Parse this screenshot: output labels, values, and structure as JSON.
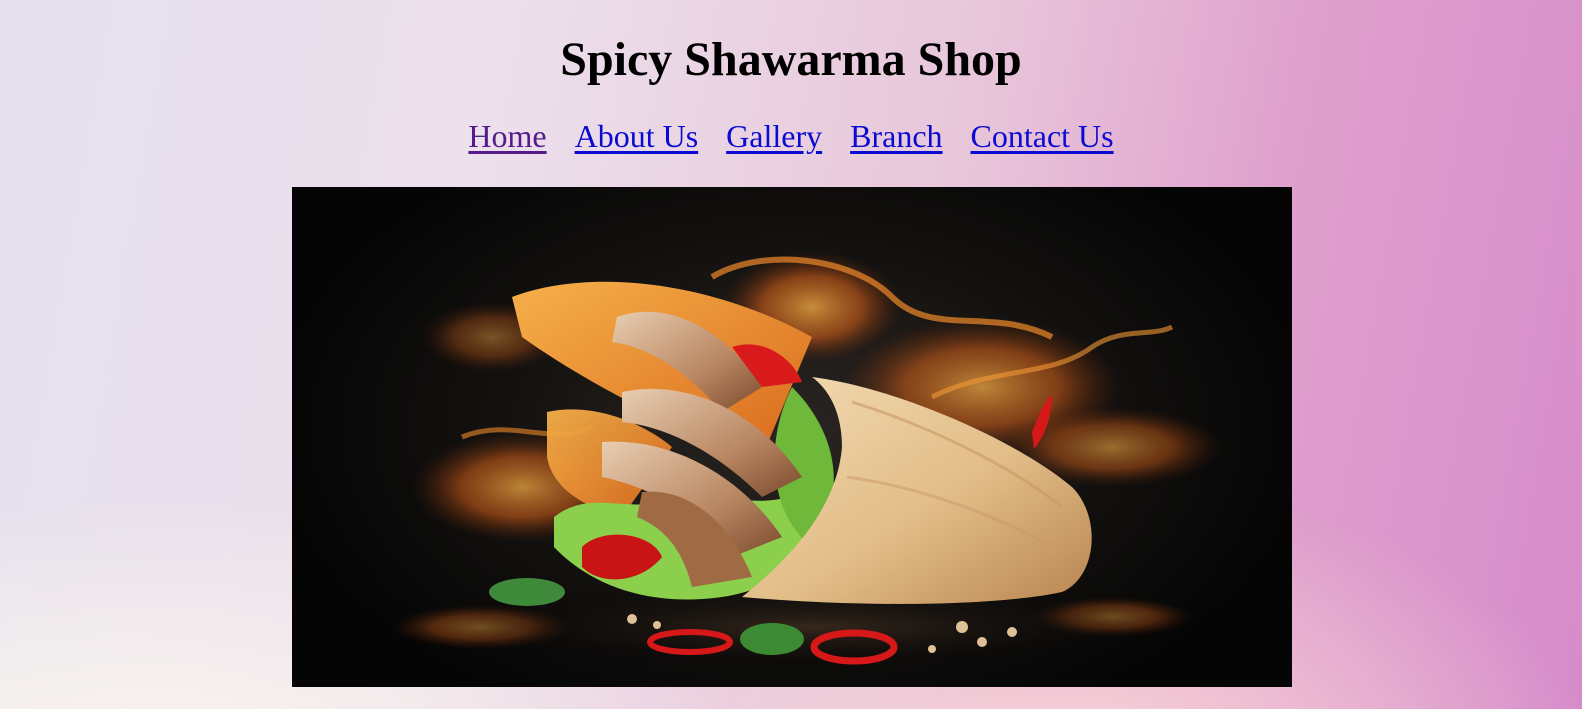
{
  "header": {
    "title": "Spicy Shawarma Shop"
  },
  "nav": {
    "items": [
      {
        "label": "Home",
        "visited": true
      },
      {
        "label": "About Us",
        "visited": false
      },
      {
        "label": "Gallery",
        "visited": false
      },
      {
        "label": "Branch",
        "visited": false
      },
      {
        "label": "Contact Us",
        "visited": false
      }
    ]
  },
  "colors": {
    "link": "#0a0ad2",
    "visited_link": "#551a8b",
    "background_start": "#e6e1ee",
    "background_end": "#d68ccb"
  },
  "hero": {
    "icon": "shawarma-wrap-photo"
  }
}
